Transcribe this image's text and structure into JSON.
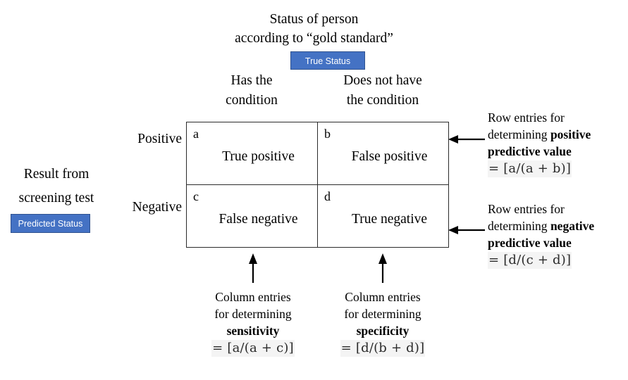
{
  "diagram": {
    "top_heading": {
      "line1": "Status of person",
      "line2": "according to “gold standard”"
    },
    "badges": {
      "true_status": "True Status",
      "predicted_status": "Predicted Status"
    },
    "column_headers": [
      {
        "line1": "Has the",
        "line2": "condition"
      },
      {
        "line1": "Does not have",
        "line2": "the condition"
      }
    ],
    "left_axis_label": {
      "line1": "Result from",
      "line2": "screening test"
    },
    "row_labels": [
      "Positive",
      "Negative"
    ],
    "cells": [
      {
        "key": "a",
        "desc": "True positive"
      },
      {
        "key": "b",
        "desc": "False positive"
      },
      {
        "key": "c",
        "desc": "False negative"
      },
      {
        "key": "d",
        "desc": "True negative"
      }
    ],
    "side_notes": [
      {
        "line1": "Row entries for",
        "line2_plain": "determining ",
        "line2_bold": "positive",
        "line3_bold": "predictive value",
        "formula": "= [a/(a + b)]"
      },
      {
        "line1": "Row entries for",
        "line2_plain": "determining ",
        "line2_bold": "negative",
        "line3_bold": "predictive value",
        "formula": "= [d/(c + d)]"
      }
    ],
    "bottom_notes": [
      {
        "line1": "Column entries",
        "line2": "for determining",
        "line3_bold": "sensitivity",
        "formula": "= [a/(a + c)]"
      },
      {
        "line1": "Column entries",
        "line2": "for determining",
        "line3_bold": "specificity",
        "formula": "= [d/(b + d)]"
      }
    ],
    "colors": {
      "badge_fill": "#4472C4",
      "badge_border": "#2F528F",
      "table_border": "#2B2B2B",
      "formula_highlight": "#F4F4F4",
      "text": "#000000"
    }
  }
}
